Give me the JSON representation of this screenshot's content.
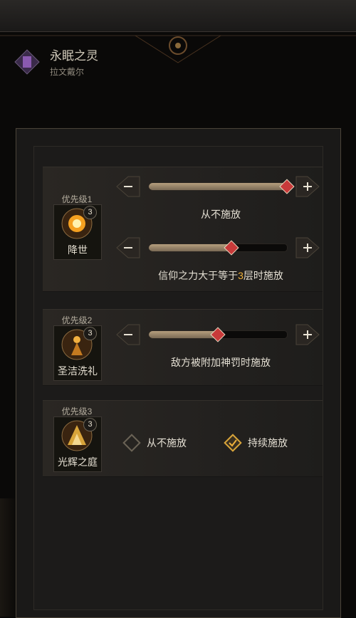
{
  "hero": {
    "name": "永眠之灵",
    "subtitle": "拉文戴尔"
  },
  "skills": [
    {
      "priority": "优先级1",
      "level": "3",
      "name": "降世",
      "conditions": [
        {
          "caption": "从不施放",
          "value_fraction": 1.0
        },
        {
          "caption_prefix": "信仰之力大于等于",
          "caption_highlight": "3",
          "caption_suffix": "层时施放",
          "value_fraction": 0.6
        }
      ]
    },
    {
      "priority": "优先级2",
      "level": "3",
      "name": "圣洁洗礼",
      "conditions": [
        {
          "caption": "敌方被附加神罚时施放",
          "value_fraction": 0.5
        }
      ]
    },
    {
      "priority": "优先级3",
      "level": "3",
      "name": "光辉之庭",
      "options": [
        {
          "label": "从不施放",
          "checked": false
        },
        {
          "label": "持续施放",
          "checked": true
        }
      ]
    }
  ],
  "colors": {
    "accent": "#f0b13a",
    "knob": "#c83a3a",
    "panel": "#1a1918"
  }
}
